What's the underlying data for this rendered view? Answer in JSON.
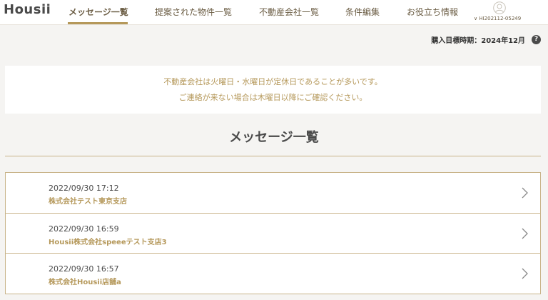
{
  "header": {
    "logo": "Housii",
    "nav": [
      {
        "label": "メッセージ一覧"
      },
      {
        "label": "提案された物件一覧"
      },
      {
        "label": "不動産会社一覧"
      },
      {
        "label": "条件編集"
      },
      {
        "label": "お役立ち情報"
      }
    ],
    "user_id": "∨ HI202112-05249"
  },
  "purchase_target": "購入目標時期：2024年12月",
  "help_icon_glyph": "?",
  "notice": {
    "line1": "不動産会社は火曜日・水曜日が定休日であることが多いです。",
    "line2": "ご連絡が来ない場合は木曜日以降にご確認ください。"
  },
  "page_title": "メッセージ一覧",
  "messages": [
    {
      "date": "2022/09/30 17:12",
      "company": "株式会社テスト東京支店"
    },
    {
      "date": "2022/09/30 16:59",
      "company": "Housii株式会社speeeテスト支店3"
    },
    {
      "date": "2022/09/30 16:57",
      "company": "株式会社Housii店舗a"
    }
  ],
  "colors": {
    "accent": "#b5985a",
    "text": "#4a4a4a",
    "background": "#f5f4f2"
  },
  "icons": {
    "user": "user-icon",
    "help": "help-icon",
    "chevron": "chevron-right-icon"
  }
}
